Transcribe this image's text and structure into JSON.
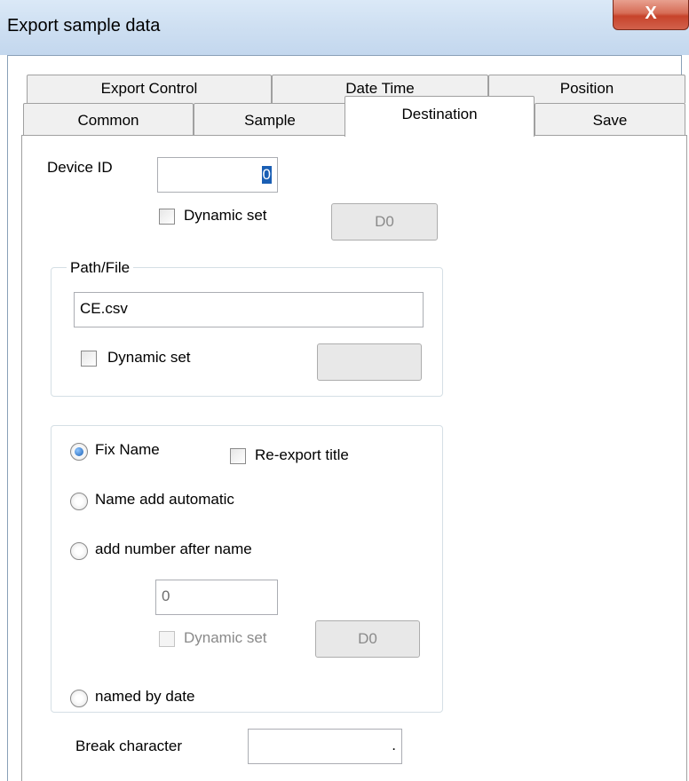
{
  "window": {
    "title": "Export sample data",
    "close_glyph": "X"
  },
  "tabs": {
    "row1": [
      "Export Control",
      "Date Time",
      "Position"
    ],
    "row2": [
      "Common",
      "Sample",
      "Destination",
      "Save"
    ],
    "active": "Destination"
  },
  "device": {
    "label": "Device ID",
    "value": "0",
    "dynamic_label": "Dynamic set",
    "dynamic_checked": false,
    "reg_button": "D0"
  },
  "path_group": {
    "title": "Path/File",
    "value": "CE.csv",
    "dynamic_label": "Dynamic set",
    "dynamic_checked": false,
    "reg_button": ""
  },
  "naming": {
    "fix_name": "Fix Name",
    "fix_name_selected": true,
    "reexport_title": "Re-export title",
    "reexport_checked": false,
    "name_add_automatic": "Name add automatic",
    "add_number_after_name": "add number after name",
    "number_value": "0",
    "dynamic_label": "Dynamic set",
    "reg_button": "D0",
    "named_by_date": "named by date"
  },
  "break": {
    "label": "Break character",
    "value": "."
  }
}
